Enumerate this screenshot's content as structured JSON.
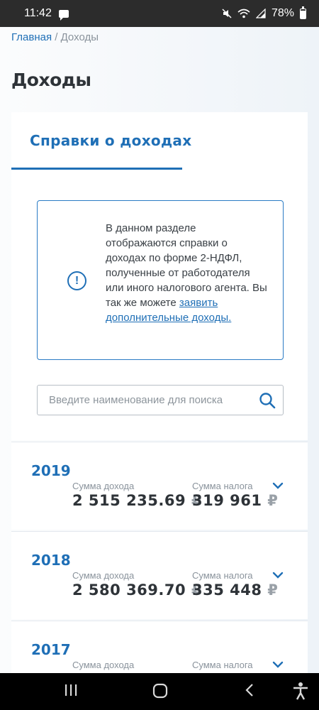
{
  "status_bar": {
    "time": "11:42",
    "battery": "78%",
    "icons": [
      "message-icon",
      "mute-icon",
      "wifi-icon",
      "signal-icon",
      "battery-icon"
    ]
  },
  "breadcrumb": {
    "home": "Главная",
    "separator": "/",
    "current": "Доходы"
  },
  "page": {
    "title": "Доходы"
  },
  "tabs": [
    {
      "label": "Справки о доходах",
      "active": true
    }
  ],
  "info": {
    "text": "В данном разделе отображаются справки о доходах по форме 2-НДФЛ, полученные от работодателя или иного налогового агента. Вы так же можете ",
    "link": "заявить дополнительные доходы."
  },
  "search": {
    "placeholder": "Введите наименование для поиска",
    "value": ""
  },
  "labels": {
    "income": "Сумма дохода",
    "tax": "Сумма налога",
    "currency": "₽"
  },
  "years": [
    {
      "year": "2019",
      "income": "2 515 235.69",
      "tax": "319 961"
    },
    {
      "year": "2018",
      "income": "2 580 369.70",
      "tax": "335 448"
    },
    {
      "year": "2017",
      "income": "",
      "tax": ""
    }
  ],
  "nav_bar": {
    "icons": [
      "recents-icon",
      "home-icon",
      "back-icon",
      "accessibility-icon"
    ]
  },
  "colors": {
    "accent": "#1f6fb6",
    "text": "#2e3338",
    "muted": "#8a939c"
  }
}
